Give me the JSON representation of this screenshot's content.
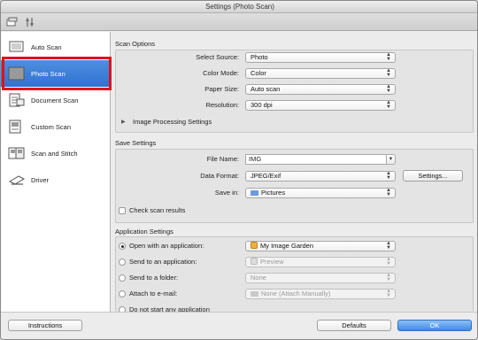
{
  "window": {
    "title": "Settings (Photo Scan)"
  },
  "toolbar": {
    "icons": [
      "scan-from-computer-icon",
      "scan-from-panel-icon"
    ]
  },
  "sidebar": {
    "items": [
      {
        "label": "Auto Scan",
        "icon": "auto-scan-icon",
        "selected": false
      },
      {
        "label": "Photo Scan",
        "icon": "photo-scan-icon",
        "selected": true
      },
      {
        "label": "Document Scan",
        "icon": "document-scan-icon",
        "selected": false
      },
      {
        "label": "Custom Scan",
        "icon": "custom-scan-icon",
        "selected": false
      },
      {
        "label": "Scan and Stitch",
        "icon": "scan-and-stitch-icon",
        "selected": false
      },
      {
        "label": "Driver",
        "icon": "driver-icon",
        "selected": false
      }
    ],
    "highlight_color": "#e0121b",
    "selected_color": "#2f72d0"
  },
  "scan_options": {
    "title": "Scan Options",
    "select_source": {
      "label": "Select Source:",
      "value": "Photo"
    },
    "color_mode": {
      "label": "Color Mode:",
      "value": "Color"
    },
    "paper_size": {
      "label": "Paper Size:",
      "value": "Auto scan"
    },
    "resolution": {
      "label": "Resolution:",
      "value": "300 dpi"
    },
    "image_processing": "Image Processing Settings"
  },
  "save_settings": {
    "title": "Save Settings",
    "file_name": {
      "label": "File Name:",
      "value": "IMG"
    },
    "data_format": {
      "label": "Data Format:",
      "value": "JPEG/Exif"
    },
    "settings_button": "Settings...",
    "save_in": {
      "label": "Save in:",
      "value": "Pictures"
    },
    "check_scan_results": {
      "label": "Check scan results",
      "checked": false
    }
  },
  "application_settings": {
    "title": "Application Settings",
    "options": [
      {
        "label": "Open with an application:",
        "value": "My Image Garden",
        "selected": true,
        "enabled": true
      },
      {
        "label": "Send to an application:",
        "value": "Preview",
        "selected": false,
        "enabled": false
      },
      {
        "label": "Send to a folder:",
        "value": "None",
        "selected": false,
        "enabled": false
      },
      {
        "label": "Attach to e-mail:",
        "value": "None (Attach Manually)",
        "selected": false,
        "enabled": false
      },
      {
        "label": "Do not start any application",
        "selected": false
      }
    ]
  },
  "footer": {
    "instructions": "Instructions",
    "defaults": "Defaults",
    "ok": "OK",
    "ok_color": "#3f8be8"
  }
}
